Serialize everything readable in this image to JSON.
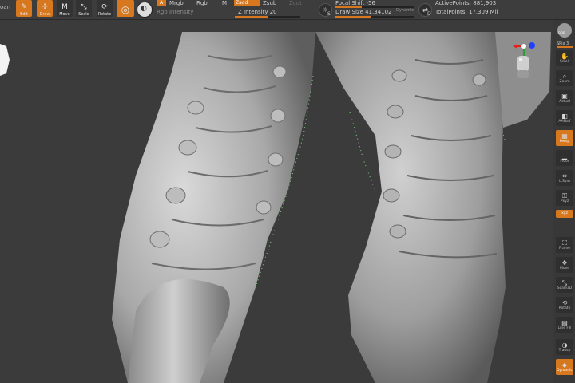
{
  "toolbar": {
    "edit_label": "Edit",
    "draw_label": "Draw",
    "move_label": "Move",
    "scale_label": "Scale",
    "rotate_label": "Rotate",
    "a_label": "A",
    "mrgb_label": "Mrgb",
    "rgb_label": "Rgb",
    "m_label": "M",
    "rgb_intensity_label": "Rgb Intensity",
    "zadd_label": "Zadd",
    "zsub_label": "Zsub",
    "zcut_label": "Zcut",
    "z_intensity_label": "Z Intensity 20",
    "focal_shift_label": "Focal Shift -56",
    "draw_size_label": "Draw Size 41.34102",
    "dynamic_label": "Dynamic",
    "active_points_label": "ActivePoints: 881,903",
    "total_points_label": "TotalPoints: 17.309 Mil",
    "s_label": "S",
    "d_label": "D",
    "left_edge_label": "oan"
  },
  "right_rail": {
    "bpr_label": "BPR",
    "spix_label": "SPix 3",
    "items": [
      {
        "label": "Scroll",
        "icon": "hand-icon"
      },
      {
        "label": "Zoom",
        "icon": "zoom-icon"
      },
      {
        "label": "Actual",
        "icon": "actual-icon"
      },
      {
        "label": "AAHalf",
        "icon": "aahalf-icon"
      },
      {
        "label": "Persp",
        "icon": "persp-icon"
      },
      {
        "label": "Floor",
        "icon": "floor-icon"
      },
      {
        "label": "L.Sym",
        "icon": "lsym-icon"
      },
      {
        "label": "Pxyz",
        "icon": "lock-icon"
      },
      {
        "label": "Frame",
        "icon": "frame-icon"
      },
      {
        "label": "Move",
        "icon": "move-icon"
      },
      {
        "label": "Scale3D",
        "icon": "scale-icon"
      },
      {
        "label": "Rotate",
        "icon": "rotate-icon"
      },
      {
        "label": "Line Fill",
        "icon": "polyf-icon"
      },
      {
        "label": "Transp",
        "icon": "transp-icon"
      },
      {
        "label": "Dynamic",
        "icon": "dynamic-icon"
      }
    ],
    "xyz_label": "xyz"
  },
  "colors": {
    "accent": "#d8781e",
    "toolbar_bg": "#3d3d3d",
    "canvas_bg": "#3c3c3c"
  }
}
